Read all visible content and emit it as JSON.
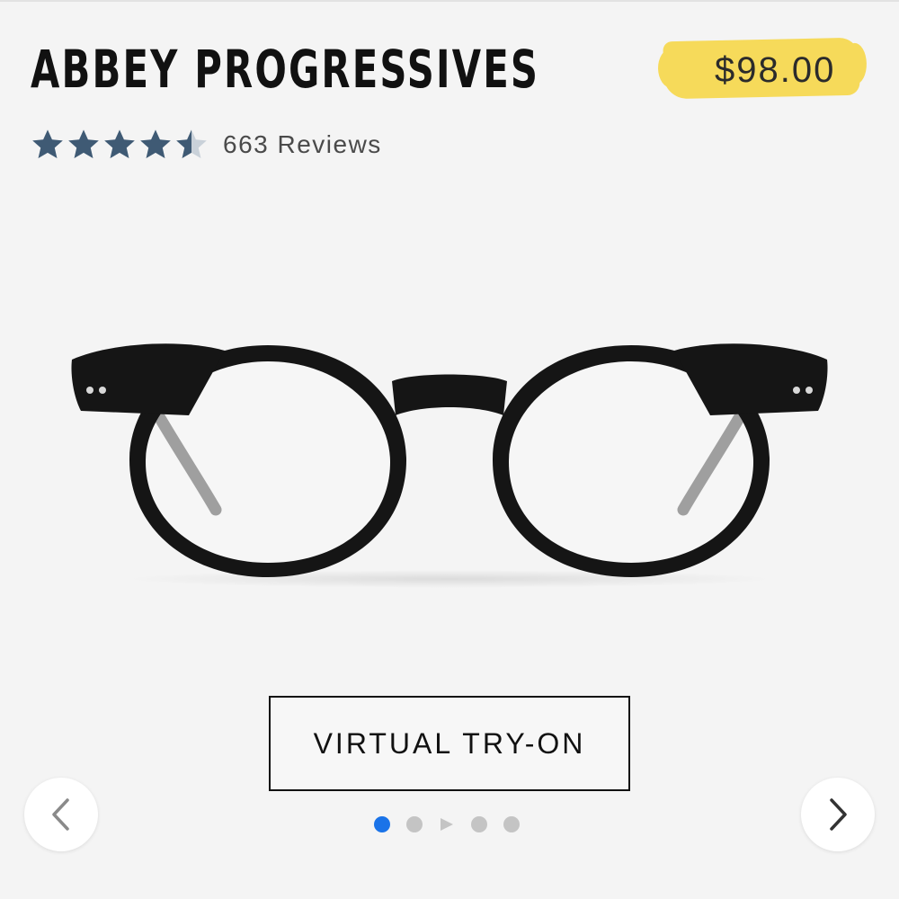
{
  "product": {
    "title": "ABBEY PROGRESSIVES",
    "price": "$98.00",
    "rating_stars": 4.5,
    "rating_max": 5,
    "reviews_label": "663 Reviews",
    "image_icon": "eyeglasses-image"
  },
  "actions": {
    "try_on_label": "VIRTUAL TRY-ON"
  },
  "carousel": {
    "total_slides": 5,
    "active_index": 0,
    "video_index": 2,
    "prev_icon": "chevron-left-icon",
    "next_icon": "chevron-right-icon"
  },
  "colors": {
    "background": "#f4f4f4",
    "star": "#3f5a74",
    "price_highlight": "#f7d84e",
    "active_dot": "#1a73e8",
    "inactive_dot": "#c4c4c4"
  }
}
